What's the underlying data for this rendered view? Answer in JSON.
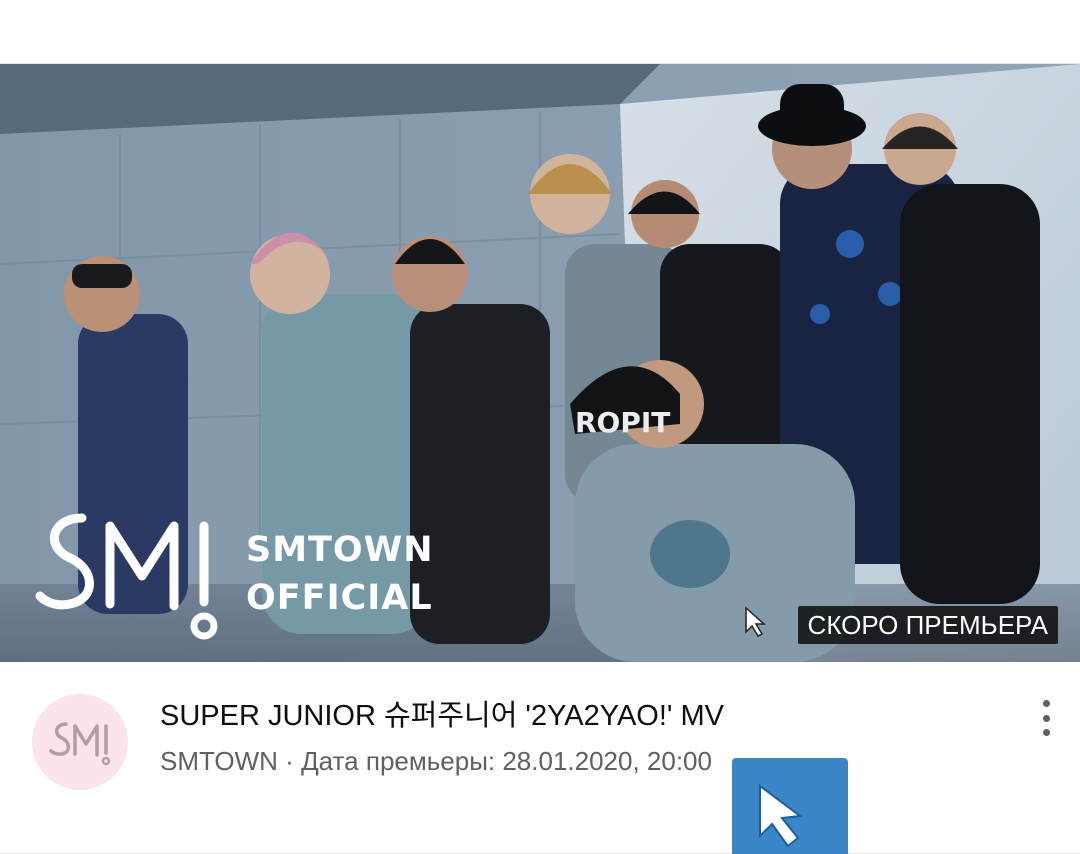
{
  "video": {
    "title": "SUPER JUNIOR 슈퍼주니어 '2YA2YAO!' MV",
    "channel": "SMTOWN",
    "separator": " · ",
    "premiere_label": "Дата премьеры: 28.01.2020, 20:00"
  },
  "thumbnail": {
    "logo_line1": "SMTOWN",
    "logo_line2": "OFFICIAL",
    "badge": "СКОРО ПРЕМЬЕРА",
    "cap_text": "ROPIT"
  },
  "icons": {
    "more": "more-vert-icon",
    "avatar": "sm-logo-icon",
    "pointer": "cursor-arrow-icon",
    "overlay": "cursor-arrow-icon"
  },
  "colors": {
    "title": "#0f0f0f",
    "secondary": "#606060",
    "avatar_bg": "#fbe5ea",
    "overlay_blue": "#3a86c8",
    "badge_bg": "#000000"
  }
}
